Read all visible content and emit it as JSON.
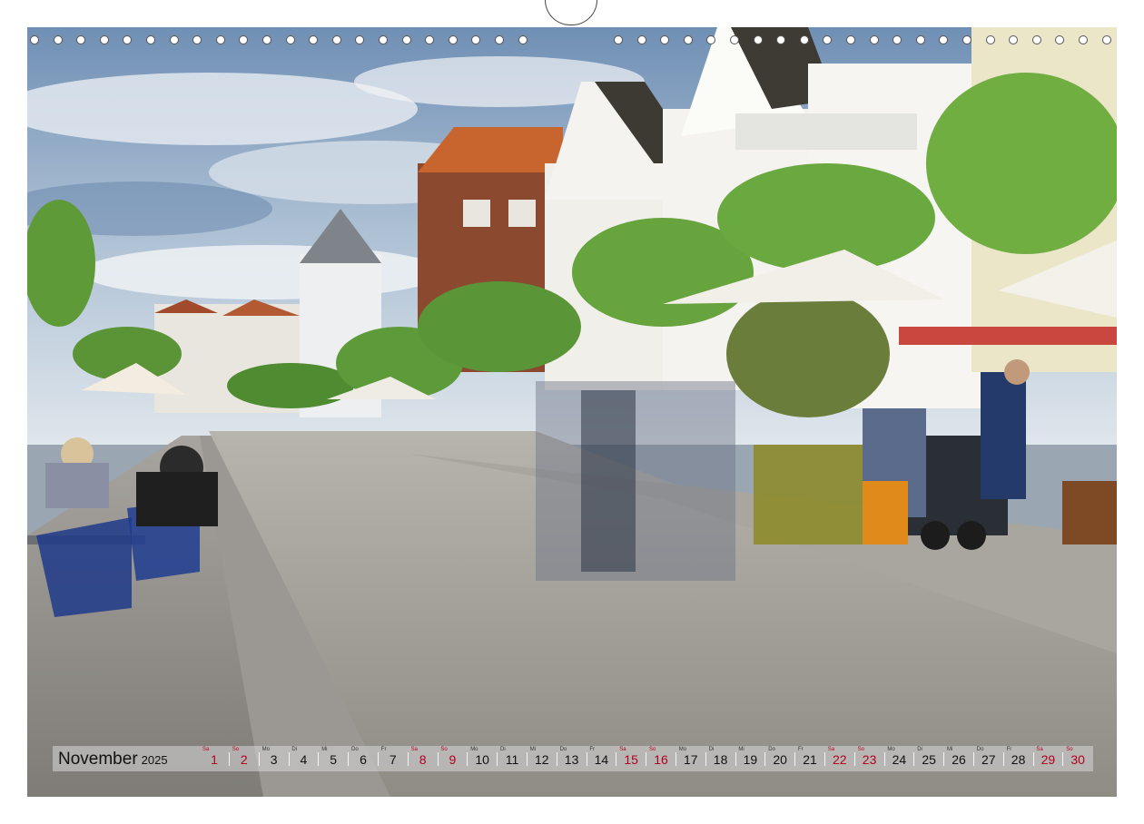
{
  "calendar": {
    "month": "November",
    "year": "2025",
    "weekend_color": "#b00020",
    "days": [
      {
        "d": "1",
        "n": "Sa",
        "we": true
      },
      {
        "d": "2",
        "n": "So",
        "we": true
      },
      {
        "d": "3",
        "n": "Mo",
        "we": false
      },
      {
        "d": "4",
        "n": "Di",
        "we": false
      },
      {
        "d": "5",
        "n": "Mi",
        "we": false
      },
      {
        "d": "6",
        "n": "Do",
        "we": false
      },
      {
        "d": "7",
        "n": "Fr",
        "we": false
      },
      {
        "d": "8",
        "n": "Sa",
        "we": true
      },
      {
        "d": "9",
        "n": "So",
        "we": true
      },
      {
        "d": "10",
        "n": "Mo",
        "we": false
      },
      {
        "d": "11",
        "n": "Di",
        "we": false
      },
      {
        "d": "12",
        "n": "Mi",
        "we": false
      },
      {
        "d": "13",
        "n": "Do",
        "we": false
      },
      {
        "d": "14",
        "n": "Fr",
        "we": false
      },
      {
        "d": "15",
        "n": "Sa",
        "we": true
      },
      {
        "d": "16",
        "n": "So",
        "we": true
      },
      {
        "d": "17",
        "n": "Mo",
        "we": false
      },
      {
        "d": "18",
        "n": "Di",
        "we": false
      },
      {
        "d": "19",
        "n": "Mi",
        "we": false
      },
      {
        "d": "20",
        "n": "Do",
        "we": false
      },
      {
        "d": "21",
        "n": "Fr",
        "we": false
      },
      {
        "d": "22",
        "n": "Sa",
        "we": true
      },
      {
        "d": "23",
        "n": "So",
        "we": true
      },
      {
        "d": "24",
        "n": "Mo",
        "we": false
      },
      {
        "d": "25",
        "n": "Di",
        "we": false
      },
      {
        "d": "26",
        "n": "Mi",
        "we": false
      },
      {
        "d": "27",
        "n": "Do",
        "we": false
      },
      {
        "d": "28",
        "n": "Fr",
        "we": false
      },
      {
        "d": "29",
        "n": "Sa",
        "we": true
      },
      {
        "d": "30",
        "n": "So",
        "we": true
      }
    ]
  }
}
